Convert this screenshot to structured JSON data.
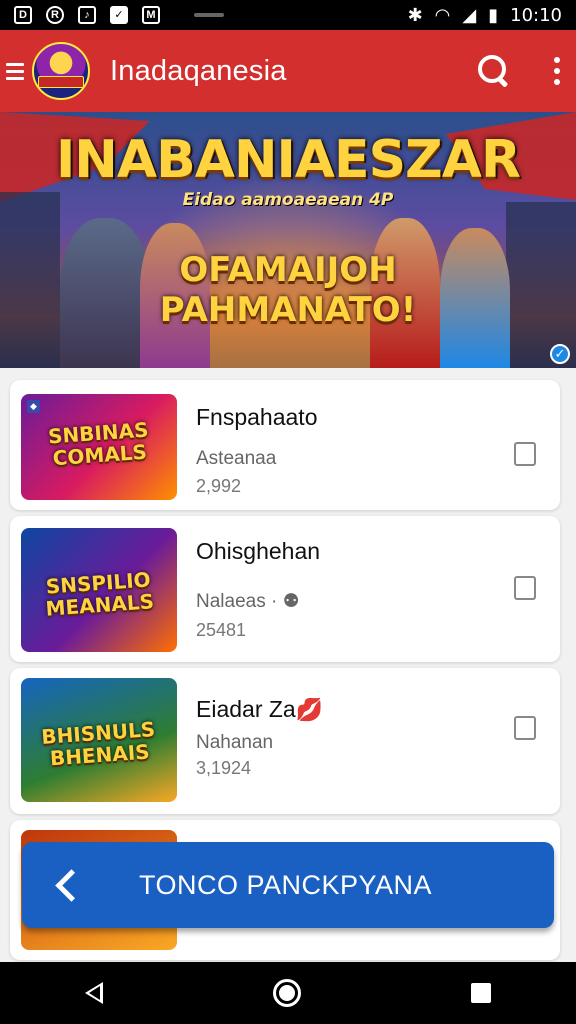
{
  "status_bar": {
    "time": "10:10",
    "left_icons": [
      "D",
      "R",
      "♪",
      "✓",
      "M"
    ],
    "right_icons": [
      "bluetooth-icon",
      "wifi-icon",
      "signal-icon",
      "battery-icon"
    ]
  },
  "app_bar": {
    "title": "Inadaqanesia",
    "icons": [
      "menu-icon",
      "app-logo",
      "search-icon",
      "more-vert-icon"
    ]
  },
  "banner": {
    "title": "INABANIAESZAR",
    "subtitle": "Eidao aamoaeaean 4P",
    "headline_line1": "OFAMAIJOH",
    "headline_line2": "PAHMANATO!"
  },
  "items": [
    {
      "title": "Fnspahaato",
      "subtitle": "Asteanaa",
      "count": "2,992",
      "thumb_text": "SNBINAS COMALS",
      "checked": false,
      "thumb_colors": [
        "#6a1b9a",
        "#d81b60",
        "#ff8f00"
      ]
    },
    {
      "title": "Ohisghehan",
      "subtitle": "Nalaeas · ⚉",
      "count": "25481",
      "thumb_text": "SNSPILIO MEANALS",
      "checked": false,
      "thumb_colors": [
        "#0d47a1",
        "#6a1b9a",
        "#ff6f00"
      ]
    },
    {
      "title": "Eiadar Za",
      "title_emoji": "💋",
      "subtitle": "Nahanan",
      "count": "3,1924",
      "thumb_text": "BHISNULS BHENAIS",
      "checked": false,
      "thumb_colors": [
        "#1565c0",
        "#2e7d32",
        "#f9a825"
      ]
    }
  ],
  "back_button": {
    "label": "TONCO PANCKPYANA"
  },
  "colors": {
    "app_bar": "#d32f2f",
    "back_button": "#1a5fc2"
  }
}
